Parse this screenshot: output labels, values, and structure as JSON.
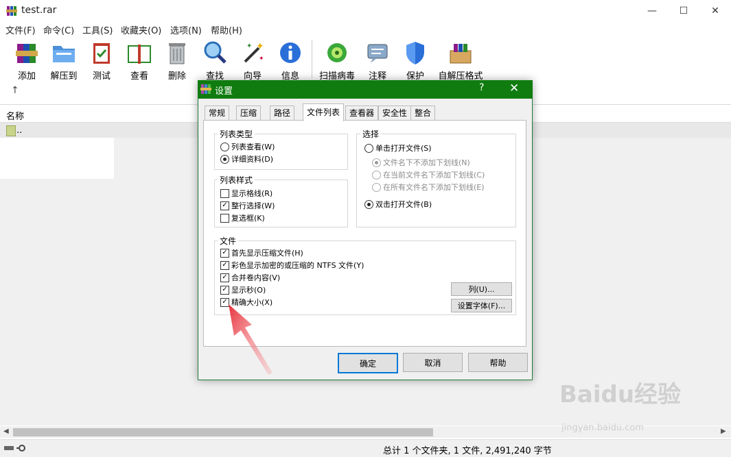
{
  "window": {
    "title": "test.rar",
    "minimize": "—",
    "maximize": "☐",
    "close": "✕"
  },
  "menu": [
    "文件(F)",
    "命令(C)",
    "工具(S)",
    "收藏夹(O)",
    "选项(N)",
    "帮助(H)"
  ],
  "toolbar": [
    {
      "label": "添加",
      "icon": "add-archive-icon"
    },
    {
      "label": "解压到",
      "icon": "extract-folder-icon"
    },
    {
      "label": "测试",
      "icon": "test-clipboard-icon"
    },
    {
      "label": "查看",
      "icon": "view-book-icon"
    },
    {
      "label": "删除",
      "icon": "trash-icon"
    },
    {
      "label": "查找",
      "icon": "magnifier-icon"
    },
    {
      "label": "向导",
      "icon": "wizard-wand-icon"
    },
    {
      "label": "信息",
      "icon": "info-icon"
    },
    {
      "label": "扫描病毒",
      "icon": "virus-scan-icon"
    },
    {
      "label": "注释",
      "icon": "comment-icon"
    },
    {
      "label": "保护",
      "icon": "shield-icon"
    },
    {
      "label": "自解压格式",
      "icon": "sfx-box-icon"
    }
  ],
  "nav": {
    "up": "↑"
  },
  "list": {
    "column_name": "名称",
    "parent_row": ".."
  },
  "status": {
    "text": "总计 1 个文件夹, 1 文件, 2,491,240 字节"
  },
  "dialog": {
    "title": "设置",
    "help": "?",
    "close": "✕",
    "tabs": [
      "常规",
      "压缩",
      "路径",
      "文件列表",
      "查看器",
      "安全性",
      "整合"
    ],
    "active_tab": "文件列表",
    "list_type": {
      "label": "列表类型",
      "options": [
        {
          "label": "列表查看(W)",
          "checked": false
        },
        {
          "label": "详细资料(D)",
          "checked": true
        }
      ]
    },
    "list_style": {
      "label": "列表样式",
      "options": [
        {
          "label": "显示格线(R)",
          "checked": false
        },
        {
          "label": "整行选择(W)",
          "checked": true
        },
        {
          "label": "复选框(K)",
          "checked": false
        }
      ]
    },
    "select": {
      "label": "选择",
      "single_click": {
        "label": "单击打开文件(S)",
        "checked": false
      },
      "sub_options": [
        {
          "label": "文件名下不添加下划线(N)",
          "checked": true
        },
        {
          "label": "在当前文件名下添加下划线(C)",
          "checked": false
        },
        {
          "label": "在所有文件名下添加下划线(E)",
          "checked": false
        }
      ],
      "double_click": {
        "label": "双击打开文件(B)",
        "checked": true
      }
    },
    "files": {
      "label": "文件",
      "options": [
        {
          "label": "首先显示压缩文件(H)",
          "checked": true
        },
        {
          "label": "彩色显示加密的或压缩的 NTFS 文件(Y)",
          "checked": true
        },
        {
          "label": "合并卷内容(V)",
          "checked": true
        },
        {
          "label": "显示秒(O)",
          "checked": true
        },
        {
          "label": "精确大小(X)",
          "checked": true
        }
      ],
      "columns_button": "列(U)...",
      "font_button": "设置字体(F)..."
    },
    "buttons": {
      "ok": "确定",
      "cancel": "取消",
      "help": "帮助"
    }
  },
  "watermark": {
    "brand": "Baidu经验",
    "url": "jingyan.baidu.com"
  },
  "colors": {
    "dialog_title": "#107c10",
    "arrow": "#e8323c",
    "ok_border": "#0078d7"
  }
}
